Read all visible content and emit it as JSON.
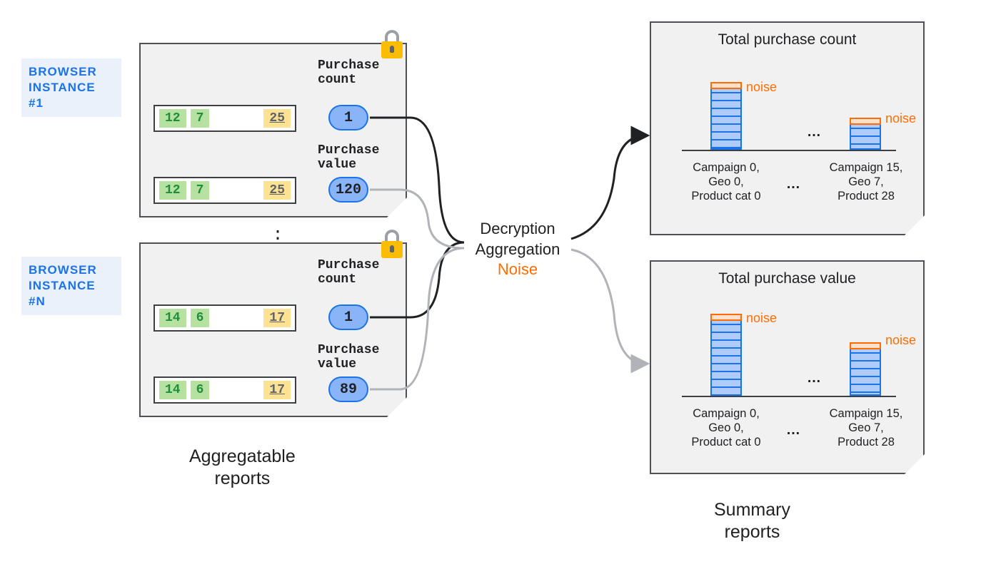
{
  "browsers": {
    "tag1_l1": "BROWSER",
    "tag1_l2": "INSTANCE #1",
    "tagN_l1": "BROWSER",
    "tagN_l2": "INSTANCE #N"
  },
  "panel1": {
    "row1": {
      "a": "12",
      "b": "7",
      "c": "25"
    },
    "row2": {
      "a": "12",
      "b": "7",
      "c": "25"
    },
    "count_label": "Purchase\ncount",
    "count_value": "1",
    "value_label": "Purchase\nvalue",
    "value_value": "120"
  },
  "panel2": {
    "row1": {
      "a": "14",
      "b": "6",
      "c": "17"
    },
    "row2": {
      "a": "14",
      "b": "6",
      "c": "17"
    },
    "count_label": "Purchase\ncount",
    "count_value": "1",
    "value_label": "Purchase\nvalue",
    "value_value": "89"
  },
  "between_dots": "⋮",
  "middle": {
    "l1": "Decryption",
    "l2": "Aggregation",
    "l3": "Noise"
  },
  "summary1": {
    "title": "Total purchase count",
    "noise": "noise",
    "bucket1": "Campaign 0,\nGeo 0,\nProduct cat 0",
    "bucket2": "Campaign 15,\nGeo 7,\nProduct 28",
    "dots": "…"
  },
  "summary2": {
    "title": "Total purchase value",
    "noise": "noise",
    "bucket1": "Campaign 0,\nGeo 0,\nProduct cat 0",
    "bucket2": "Campaign 15,\nGeo 7,\nProduct 28",
    "dots": "…"
  },
  "captions": {
    "left": "Aggregatable\nreports",
    "right": "Summary\nreports"
  },
  "chart_data": [
    {
      "type": "bar",
      "title": "Total purchase count",
      "categories": [
        "Campaign 0, Geo 0, Product cat 0",
        "Campaign 15, Geo 7, Product 28"
      ],
      "values": [
        90,
        40
      ],
      "noise_on_each": true
    },
    {
      "type": "bar",
      "title": "Total purchase value",
      "categories": [
        "Campaign 0, Geo 0, Product cat 0",
        "Campaign 15, Geo 7, Product 28"
      ],
      "values": [
        100,
        70
      ],
      "noise_on_each": true
    }
  ]
}
